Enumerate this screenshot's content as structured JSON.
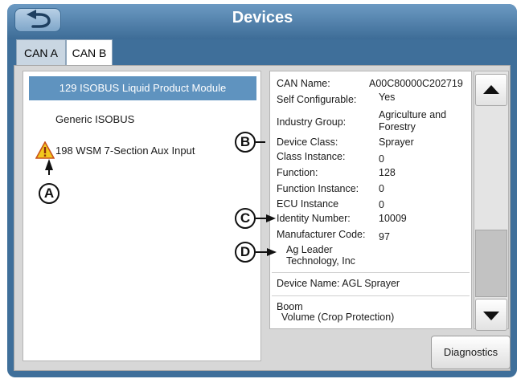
{
  "header": {
    "title": "Devices",
    "back_icon": "back-arrow-icon"
  },
  "tabs": [
    {
      "label": "CAN A",
      "active": false
    },
    {
      "label": "CAN B",
      "active": true
    }
  ],
  "device_list": [
    {
      "label": "129 ISOBUS Liquid Product Module",
      "selected": true
    },
    {
      "label": "Generic ISOBUS",
      "selected": false
    },
    {
      "label": "198 WSM 7-Section Aux Input",
      "selected": false,
      "icon": "warning-icon"
    }
  ],
  "details": {
    "can_name": {
      "label": "CAN Name:",
      "value": "A00C80000C202719"
    },
    "self_configurable": {
      "label": "Self Configurable:",
      "value": "Yes"
    },
    "industry_group": {
      "label": "Industry Group:",
      "value_line1": "Agriculture and",
      "value_line2": "Forestry"
    },
    "device_class": {
      "label": "Device Class:",
      "value": "Sprayer"
    },
    "class_instance": {
      "label": "Class Instance:",
      "value": "0"
    },
    "function": {
      "label": "Function:",
      "value": "128"
    },
    "function_instance": {
      "label": "Function Instance:",
      "value": "0"
    },
    "ecu_instance": {
      "label": "ECU Instance",
      "value": "0"
    },
    "identity_number": {
      "label": "Identity Number:",
      "value": "10009"
    },
    "manufacturer_code": {
      "label": "Manufacturer Code:",
      "value": "97"
    },
    "manufacturer_line1": "Ag Leader",
    "manufacturer_line2": "Technology, Inc",
    "device_name": "Device Name: AGL Sprayer",
    "boom_label": "Boom",
    "boom_value": "Volume (Crop Protection)"
  },
  "scrollbar": {
    "up_icon": "scroll-up-arrow-icon",
    "down_icon": "scroll-down-arrow-icon"
  },
  "diagnostics_label": "Diagnostics",
  "callouts": {
    "a": "A",
    "b": "B",
    "c": "C",
    "d": "D"
  },
  "colors": {
    "frame": "#3f6f9a",
    "selected": "#5f93bf",
    "warning": "#f2c81e"
  }
}
